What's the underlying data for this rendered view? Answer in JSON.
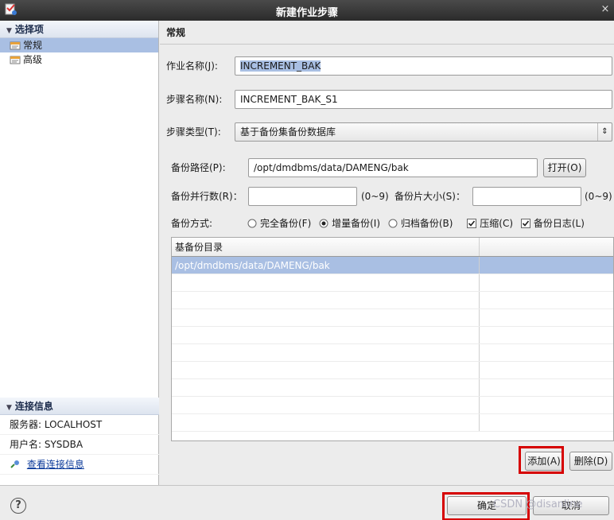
{
  "window": {
    "title": "新建作业步骤",
    "close_glyph": "×"
  },
  "left": {
    "options_header": "选择项",
    "items": [
      {
        "label": "常规",
        "selected": true
      },
      {
        "label": "高级",
        "selected": false
      }
    ],
    "connection": {
      "header": "连接信息",
      "server": "服务器: LOCALHOST",
      "user": "用户名: SYSDBA",
      "link": "查看连接信息"
    }
  },
  "right": {
    "header": "常规",
    "job_name_label": "作业名称(J):",
    "job_name_value": "INCREMENT_BAK",
    "step_name_label": "步骤名称(N):",
    "step_name_value": "INCREMENT_BAK_S1",
    "step_type_label": "步骤类型(T):",
    "step_type_value": "基于备份集备份数据库",
    "backup_path_label": "备份路径(P):",
    "backup_path_value": "/opt/dmdbms/data/DAMENG/bak",
    "open_button": "打开(O)",
    "parallel_label": "备份并行数(R)：",
    "parallel_value": "",
    "parallel_range": "(0~9)",
    "piece_label": "备份片大小(S)：",
    "piece_value": "",
    "piece_range": "(0~9)",
    "mode_label": "备份方式:",
    "modes": [
      {
        "label": "完全备份(F)",
        "checked": false
      },
      {
        "label": "增量备份(I)",
        "checked": true
      },
      {
        "label": "归档备份(B)",
        "checked": false
      }
    ],
    "compress": {
      "label": "压缩(C)",
      "checked": true
    },
    "log": {
      "label": "备份日志(L)",
      "checked": true
    },
    "table": {
      "column": "基备份目录",
      "rows": [
        "/opt/dmdbms/data/DAMENG/bak"
      ]
    },
    "add_button": "添加(A)",
    "delete_button": "删除(D)"
  },
  "footer": {
    "help": "?",
    "ok_button": "确定",
    "cancel_button": "取消",
    "watermark": "CSDN @disanline"
  },
  "colors": {
    "selection": "#a9bfe3",
    "highlight_box": "#d60000"
  }
}
